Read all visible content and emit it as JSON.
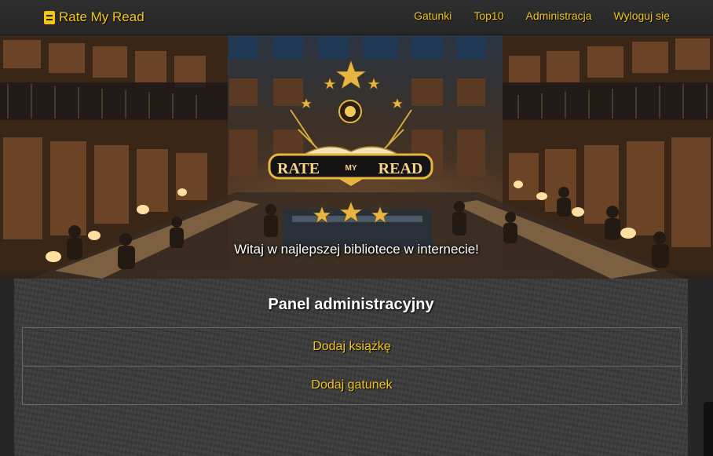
{
  "navbar": {
    "brand": "Rate My Read",
    "links": [
      "Gatunki",
      "Top10",
      "Administracja",
      "Wyloguj się"
    ]
  },
  "hero": {
    "logo_text_left": "RATE",
    "logo_text_middle": "MY",
    "logo_text_right": "READ",
    "tagline": "Witaj w najlepszej bibliotece w internecie!"
  },
  "panel": {
    "title": "Panel administracyjny",
    "actions": [
      "Dodaj książkę",
      "Dodaj gatunek"
    ]
  },
  "colors": {
    "accent": "#f5c518",
    "background": "#2b2b2b",
    "panel": "#3b3b3b"
  },
  "icons": [
    "book-icon"
  ]
}
